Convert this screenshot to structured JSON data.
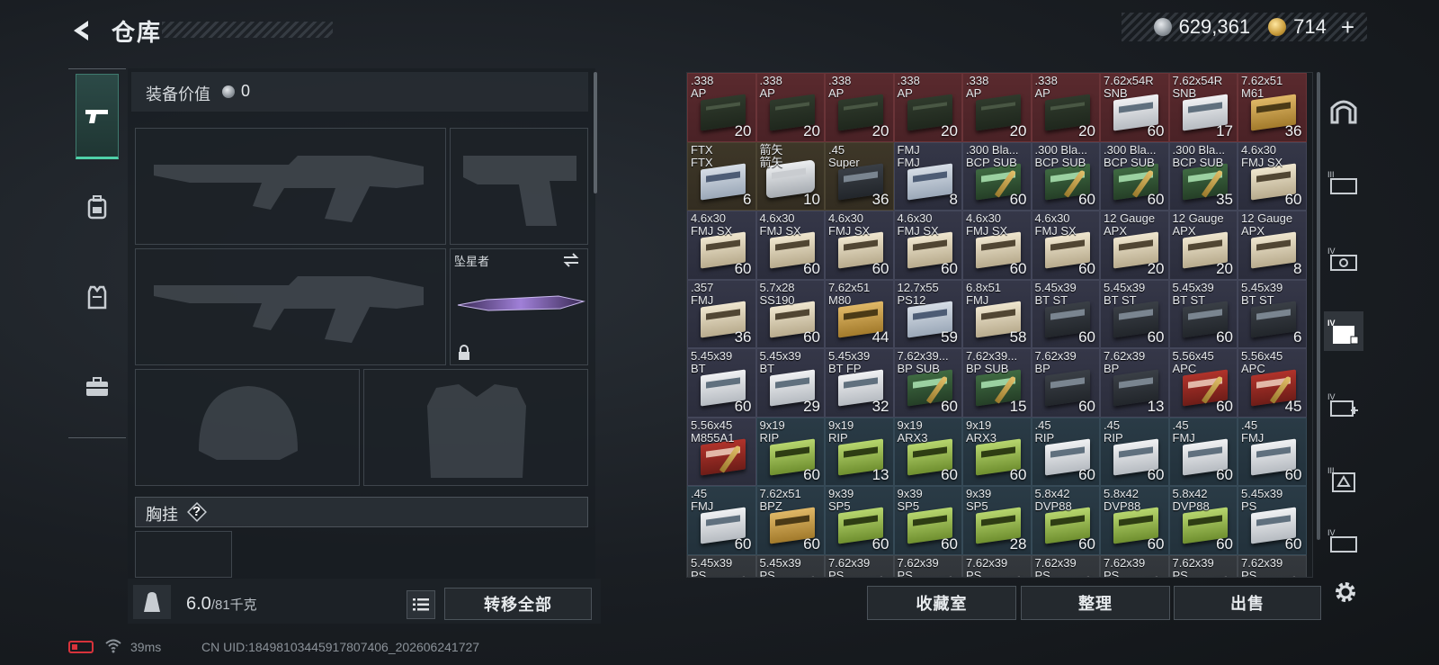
{
  "header": {
    "title": "仓库",
    "currency_silver": "629,361",
    "currency_gold": "714",
    "add_symbol": "+"
  },
  "equipment": {
    "value_label": "装备价值",
    "value": "0",
    "melee_name": "坠星者",
    "vest_label": "胸挂",
    "help_symbol": "?"
  },
  "weight": {
    "current": "6.0",
    "max": "/81千克",
    "kg_icon_text": "KG"
  },
  "buttons": {
    "transfer_all": "转移全部",
    "collection": "收藏室",
    "organize": "整理",
    "sell": "出售"
  },
  "status": {
    "ping": "39ms",
    "uid": "CN UID:1849810344591780740​6_202606241727"
  },
  "grid": {
    "items": [
      {
        "name": ".338\nAP",
        "count": "20",
        "bg": "red",
        "box": "tin"
      },
      {
        "name": ".338\nAP",
        "count": "20",
        "bg": "red",
        "box": "tin"
      },
      {
        "name": ".338\nAP",
        "count": "20",
        "bg": "red",
        "box": "tin"
      },
      {
        "name": ".338\nAP",
        "count": "20",
        "bg": "red",
        "box": "tin"
      },
      {
        "name": ".338\nAP",
        "count": "20",
        "bg": "red",
        "box": "tin"
      },
      {
        "name": ".338\nAP",
        "count": "20",
        "bg": "red",
        "box": "tin"
      },
      {
        "name": "7.62x54R\nSNB",
        "count": "60",
        "bg": "red",
        "box": "white"
      },
      {
        "name": "7.62x54R\nSNB",
        "count": "17",
        "bg": "red",
        "box": "white"
      },
      {
        "name": "7.62x51\nM61",
        "count": "36",
        "bg": "red",
        "box": "yellow"
      },
      {
        "name": "FTX\nFTX",
        "count": "6",
        "bg": "brown",
        "box": "lightblue"
      },
      {
        "name": "箭矢\n箭矢",
        "count": "10",
        "bg": "brown",
        "box": "silvertin"
      },
      {
        "name": ".45\nSuper",
        "count": "36",
        "bg": "brown",
        "box": "dark"
      },
      {
        "name": "FMJ\nFMJ",
        "count": "8",
        "bg": "purple",
        "box": "lightblue"
      },
      {
        "name": ".300 Bla...\nBCP SUB",
        "count": "60",
        "bg": "purple",
        "box": "greendark"
      },
      {
        "name": ".300 Bla...\nBCP SUB",
        "count": "60",
        "bg": "purple",
        "box": "greendark"
      },
      {
        "name": ".300 Bla...\nBCP SUB",
        "count": "60",
        "bg": "purple",
        "box": "greendark"
      },
      {
        "name": ".300 Bla...\nBCP SUB",
        "count": "35",
        "bg": "purple",
        "box": "greendark"
      },
      {
        "name": "4.6x30\nFMJ SX",
        "count": "60",
        "bg": "purple",
        "box": "cream"
      },
      {
        "name": "4.6x30\nFMJ SX",
        "count": "60",
        "bg": "purple",
        "box": "cream"
      },
      {
        "name": "4.6x30\nFMJ SX",
        "count": "60",
        "bg": "purple",
        "box": "cream"
      },
      {
        "name": "4.6x30\nFMJ SX",
        "count": "60",
        "bg": "purple",
        "box": "cream"
      },
      {
        "name": "4.6x30\nFMJ SX",
        "count": "60",
        "bg": "purple",
        "box": "cream"
      },
      {
        "name": "4.6x30\nFMJ SX",
        "count": "60",
        "bg": "purple",
        "box": "cream"
      },
      {
        "name": "4.6x30\nFMJ SX",
        "count": "60",
        "bg": "purple",
        "box": "cream"
      },
      {
        "name": "12 Gauge\nAPX",
        "count": "20",
        "bg": "purple",
        "box": "cream"
      },
      {
        "name": "12 Gauge\nAPX",
        "count": "20",
        "bg": "purple",
        "box": "cream"
      },
      {
        "name": "12 Gauge\nAPX",
        "count": "8",
        "bg": "purple",
        "box": "cream"
      },
      {
        "name": ".357\nFMJ",
        "count": "36",
        "bg": "purple",
        "box": "cream"
      },
      {
        "name": "5.7x28\nSS190",
        "count": "60",
        "bg": "purple",
        "box": "cream"
      },
      {
        "name": "7.62x51\nM80",
        "count": "44",
        "bg": "purple",
        "box": "yellow"
      },
      {
        "name": "12.7x55\nPS12",
        "count": "59",
        "bg": "purple",
        "box": "lightblue"
      },
      {
        "name": "6.8x51\nFMJ",
        "count": "58",
        "bg": "purple",
        "box": "cream"
      },
      {
        "name": "5.45x39\nBT ST",
        "count": "60",
        "bg": "purple",
        "box": "dark"
      },
      {
        "name": "5.45x39\nBT ST",
        "count": "60",
        "bg": "purple",
        "box": "dark"
      },
      {
        "name": "5.45x39\nBT ST",
        "count": "60",
        "bg": "purple",
        "box": "dark"
      },
      {
        "name": "5.45x39\nBT ST",
        "count": "6",
        "bg": "purple",
        "box": "dark"
      },
      {
        "name": "5.45x39\nBT",
        "count": "60",
        "bg": "purple",
        "box": "white"
      },
      {
        "name": "5.45x39\nBT",
        "count": "29",
        "bg": "purple",
        "box": "white"
      },
      {
        "name": "5.45x39\nBT FP",
        "count": "32",
        "bg": "purple",
        "box": "white"
      },
      {
        "name": "7.62x39...\nBP SUB",
        "count": "60",
        "bg": "purple",
        "box": "greendark"
      },
      {
        "name": "7.62x39...\nBP SUB",
        "count": "15",
        "bg": "purple",
        "box": "greendark"
      },
      {
        "name": "7.62x39\nBP",
        "count": "60",
        "bg": "purple",
        "box": "dark"
      },
      {
        "name": "7.62x39\nBP",
        "count": "13",
        "bg": "purple",
        "box": "dark"
      },
      {
        "name": "5.56x45\nAPC",
        "count": "60",
        "bg": "purple",
        "box": "redbox"
      },
      {
        "name": "5.56x45\nAPC",
        "count": "45",
        "bg": "purple",
        "box": "redbox"
      },
      {
        "name": "5.56x45\nM855A1",
        "count": "",
        "bg": "purple",
        "box": "redbox"
      },
      {
        "name": "9x19\nRIP",
        "count": "60",
        "bg": "blue",
        "box": "green"
      },
      {
        "name": "9x19\nRIP",
        "count": "13",
        "bg": "blue",
        "box": "green"
      },
      {
        "name": "9x19\nARX3",
        "count": "60",
        "bg": "blue",
        "box": "green"
      },
      {
        "name": "9x19\nARX3",
        "count": "60",
        "bg": "blue",
        "box": "green"
      },
      {
        "name": ".45\nRIP",
        "count": "60",
        "bg": "blue",
        "box": "white"
      },
      {
        "name": ".45\nRIP",
        "count": "60",
        "bg": "blue",
        "box": "white"
      },
      {
        "name": ".45\nFMJ",
        "count": "60",
        "bg": "blue",
        "box": "white"
      },
      {
        "name": ".45\nFMJ",
        "count": "60",
        "bg": "blue",
        "box": "white"
      },
      {
        "name": ".45\nFMJ",
        "count": "60",
        "bg": "blue",
        "box": "white"
      },
      {
        "name": "7.62x51\nBPZ",
        "count": "60",
        "bg": "blue",
        "box": "yellow"
      },
      {
        "name": "9x39\nSP5",
        "count": "60",
        "bg": "blue",
        "box": "green"
      },
      {
        "name": "9x39\nSP5",
        "count": "60",
        "bg": "blue",
        "box": "green"
      },
      {
        "name": "9x39\nSP5",
        "count": "28",
        "bg": "blue",
        "box": "green"
      },
      {
        "name": "5.8x42\nDVP88",
        "count": "60",
        "bg": "blue",
        "box": "green"
      },
      {
        "name": "5.8x42\nDVP88",
        "count": "60",
        "bg": "blue",
        "box": "green"
      },
      {
        "name": "5.8x42\nDVP88",
        "count": "60",
        "bg": "blue",
        "box": "green"
      },
      {
        "name": "5.45x39\nPS",
        "count": "60",
        "bg": "blue",
        "box": "white"
      },
      {
        "name": "5.45x39\nPS",
        "count": "",
        "bg": "gray",
        "box": "white"
      },
      {
        "name": "5.45x39\nPS",
        "count": "",
        "bg": "gray",
        "box": "white"
      },
      {
        "name": "7.62x39\nPS",
        "count": "",
        "bg": "gray",
        "box": "white"
      },
      {
        "name": "7.62x39\nPS",
        "count": "",
        "bg": "gray",
        "box": "white"
      },
      {
        "name": "7.62x39\nPS",
        "count": "",
        "bg": "gray",
        "box": "white"
      },
      {
        "name": "7.62x39\nPS",
        "count": "",
        "bg": "gray",
        "box": "white"
      },
      {
        "name": "7.62x39\nPS",
        "count": "",
        "bg": "gray",
        "box": "white"
      },
      {
        "name": "7.62x39\nPS",
        "count": "",
        "bg": "gray",
        "box": "white"
      },
      {
        "name": "7.62x39\nPS",
        "count": "",
        "bg": "gray",
        "box": "white"
      }
    ]
  },
  "side_icons": [
    "vault-icon",
    "tier3-case-icon",
    "tier4-case-icon",
    "tier4-folder-icon",
    "tier4-medkit-icon",
    "tier3-box-icon",
    "tier4-container-icon"
  ]
}
